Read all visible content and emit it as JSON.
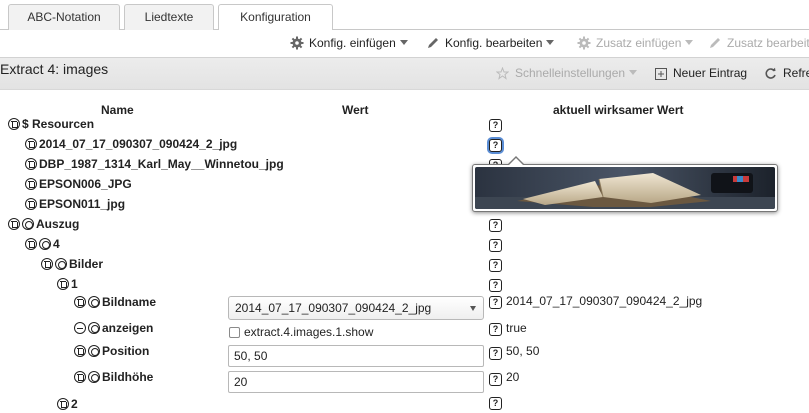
{
  "tabs": [
    {
      "label": "ABC-Notation"
    },
    {
      "label": "Liedtexte"
    },
    {
      "label": "Konfiguration"
    }
  ],
  "toolbar": {
    "insert_config": "Konfig. einfügen",
    "edit_config": "Konfig. bearbeiten",
    "insert_extra": "Zusatz einfügen",
    "edit_extra": "Zusatz bearbeiten"
  },
  "panel": {
    "title": "Extract 4: images",
    "quick_settings": "Schnelleinstellungen",
    "new_entry": "Neuer Eintrag",
    "refresh": "Refresh"
  },
  "columns": {
    "name": "Name",
    "value": "Wert",
    "effective": "aktuell wirksamer Wert"
  },
  "tree": {
    "resources": "$ Resourcen",
    "res1": "2014_07_17_090307_090424_2_jpg",
    "res2": "DBP_1987_1314_Karl_May__Winnetou_jpg",
    "res3": "EPSON006_JPG",
    "res4": "EPSON011_jpg",
    "auszug": "Auszug",
    "n4": "4",
    "bilder": "Bilder",
    "n1": "1",
    "bildname": "Bildname",
    "anzeigen": "anzeigen",
    "position": "Position",
    "bildhoehe": "Bildhöhe",
    "n2": "2"
  },
  "values": {
    "bildname_select": "2014_07_17_090307_090424_2_jpg",
    "anzeigen_checkbox": "extract.4.images.1.show",
    "position": "50, 50",
    "bildhoehe": "20"
  },
  "effective": {
    "bildname": "2014_07_17_090307_090424_2_jpg",
    "anzeigen": "true",
    "position": "50, 50",
    "bildhoehe": "20"
  },
  "help_glyph": "?",
  "colors": {
    "focus": "#5b8ed6",
    "tab_border": "#c8c8c8",
    "panel_header": "#e6e6e6"
  }
}
